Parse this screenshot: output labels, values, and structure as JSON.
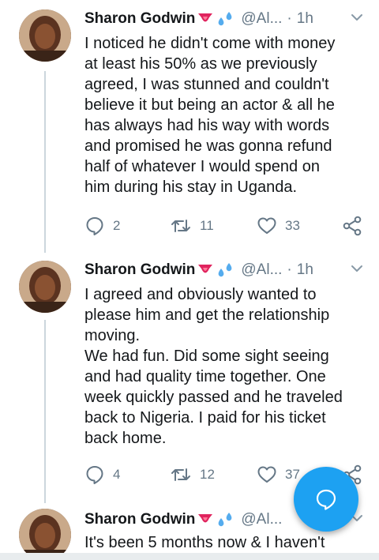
{
  "tweets": [
    {
      "name": "Sharon Godwin",
      "handle": "@Al...",
      "separator": "·",
      "time": "1h",
      "text": "I noticed he didn't come with money\nat least his 50% as we previously\nagreed, I was stunned and couldn't\nbelieve it but being an actor & all he\nhas always had his way with words\nand promised he was gonna refund\nhalf of whatever I would spend on\nhim during his stay in Uganda.",
      "replies": "2",
      "retweets": "11",
      "likes": "33"
    },
    {
      "name": "Sharon Godwin",
      "handle": "@Al...",
      "separator": "·",
      "time": "1h",
      "text": "I agreed and obviously wanted to\nplease him and get the relationship\nmoving.\nWe had fun. Did some sight seeing\nand had quality time together. One\nweek quickly passed and he traveled\nback to Nigeria. I paid for his ticket\nback home.",
      "replies": "4",
      "retweets": "12",
      "likes": "37"
    },
    {
      "name": "Sharon Godwin",
      "handle": "@Al...",
      "text": "It's been 5 months now & I haven't"
    }
  ],
  "icons": {
    "emoji_1": "tongue-emoji",
    "emoji_2": "sweat-droplets-emoji",
    "caret": "chevron-down-icon",
    "reply": "reply-icon",
    "retweet": "retweet-icon",
    "like": "heart-icon",
    "share": "share-icon",
    "fab": "compose-reply-icon"
  },
  "colors": {
    "accent": "#1da1f2",
    "muted": "#657786",
    "text": "#14171a",
    "thread_line": "#ccd6dd",
    "emoji_red": "#e0245e"
  }
}
